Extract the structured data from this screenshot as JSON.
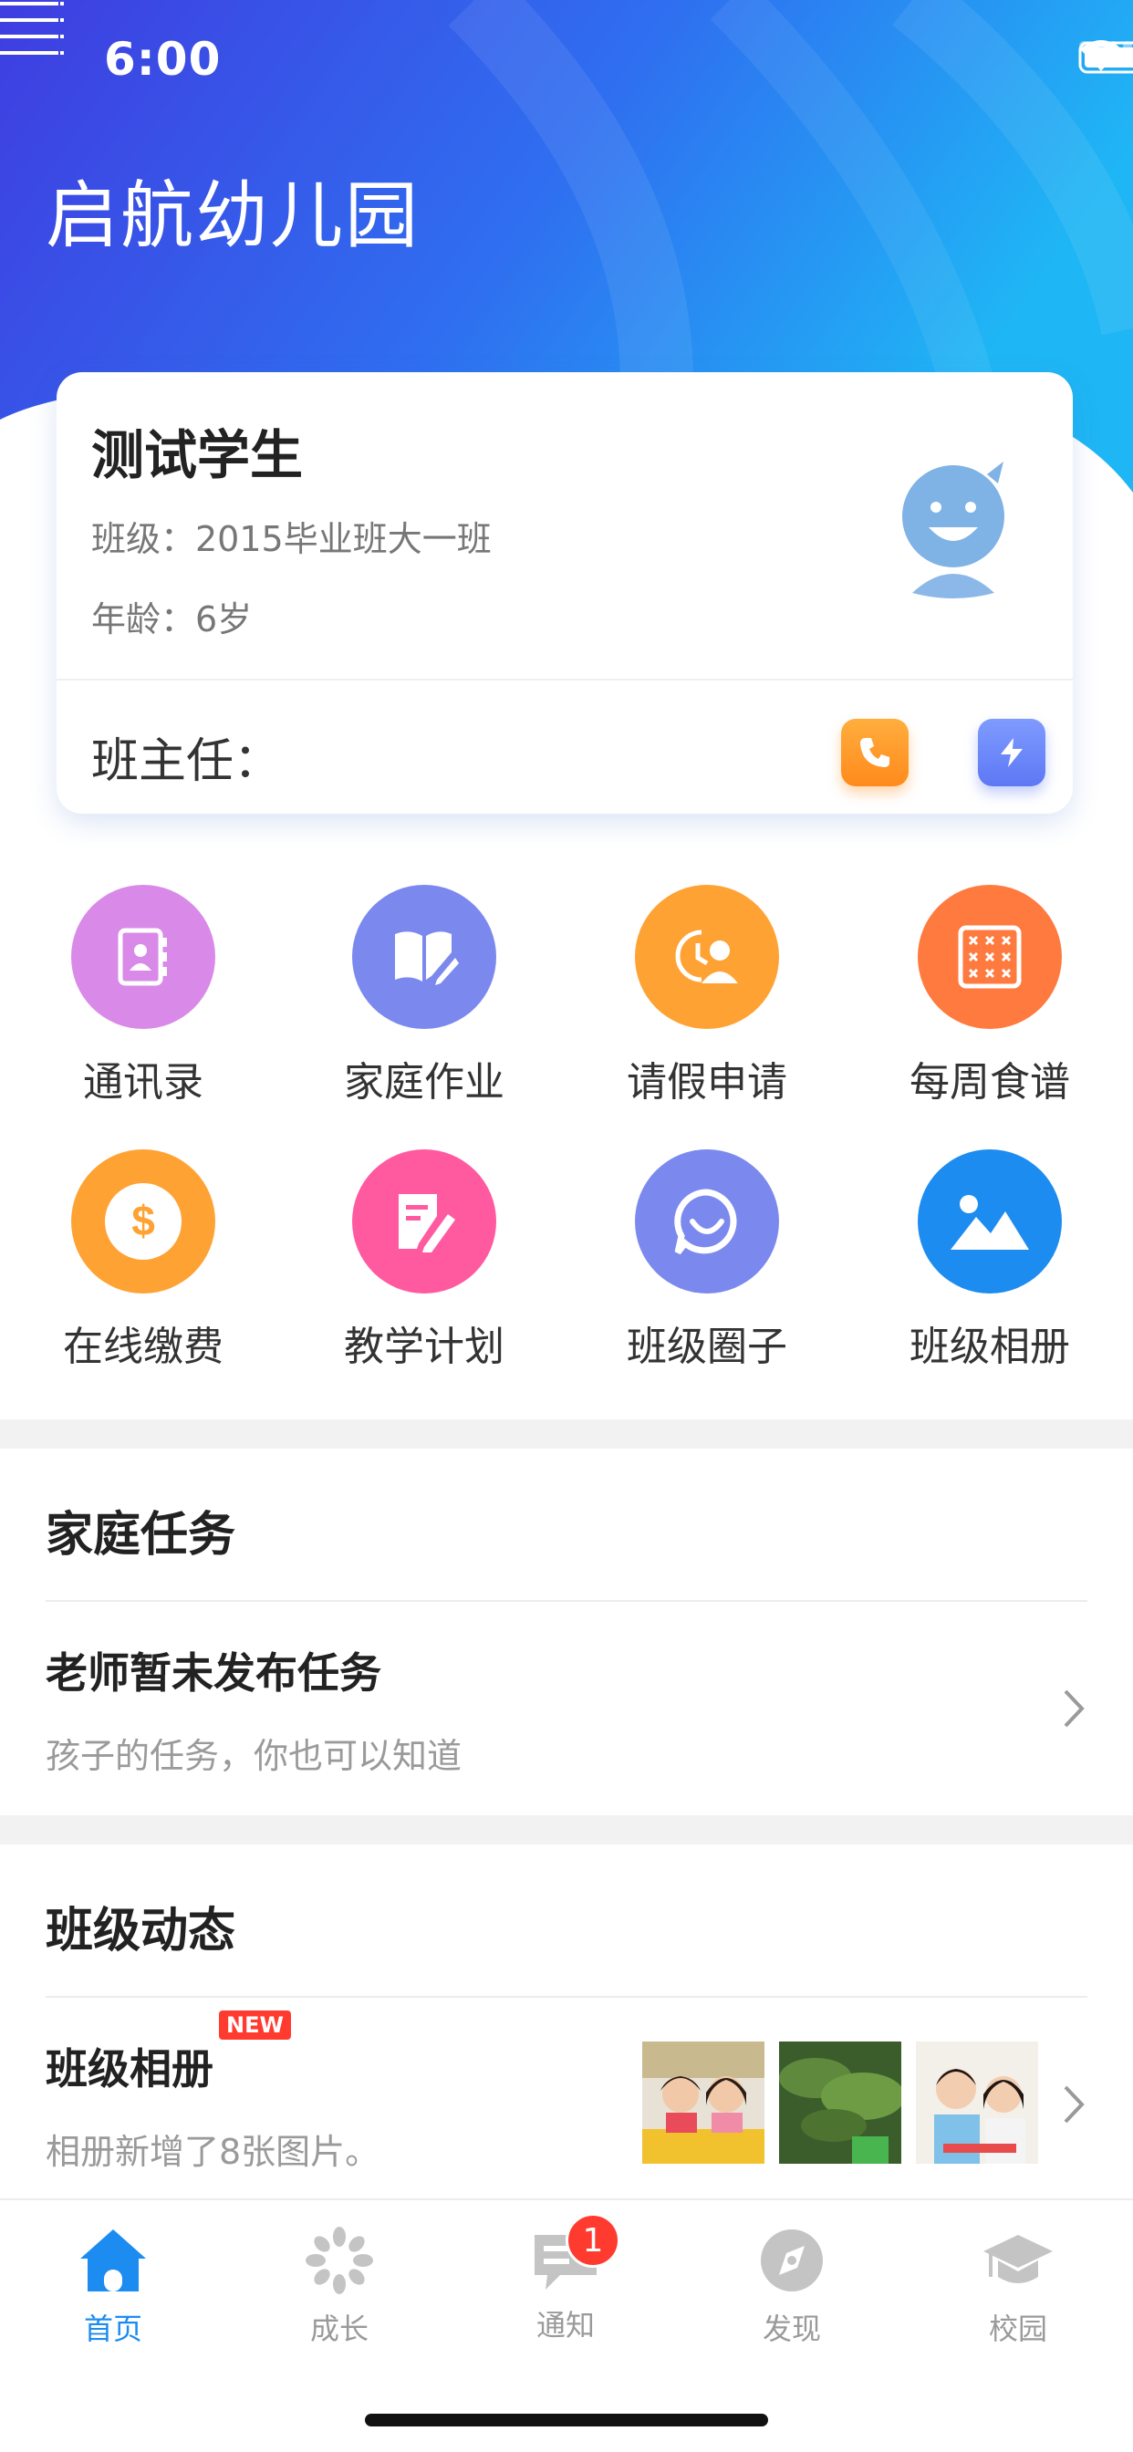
{
  "status_bar": {
    "time": "6:00"
  },
  "header": {
    "title": "启航幼儿园"
  },
  "student": {
    "name": "测试学生",
    "class_line": "班级：2015毕业班大一班",
    "age_line": "年龄：6岁",
    "teacher_label": "班主任："
  },
  "grid": [
    {
      "label": "通讯录",
      "color": "#d98ae8",
      "icon": "contacts-icon"
    },
    {
      "label": "家庭作业",
      "color": "#7b89ee",
      "icon": "book-edit-icon"
    },
    {
      "label": "请假申请",
      "color": "#ffa234",
      "icon": "leave-request-icon"
    },
    {
      "label": "每周食谱",
      "color": "#ff7a3e",
      "icon": "menu-grid-icon"
    },
    {
      "label": "在线缴费",
      "color": "#ffa234",
      "icon": "dollar-icon"
    },
    {
      "label": "教学计划",
      "color": "#ff5aa0",
      "icon": "plan-edit-icon"
    },
    {
      "label": "班级圈子",
      "color": "#7b89ee",
      "icon": "chat-smile-icon"
    },
    {
      "label": "班级相册",
      "color": "#1d8cf0",
      "icon": "image-icon"
    }
  ],
  "family_tasks": {
    "title": "家庭任务",
    "row_title": "老师暂未发布任务",
    "row_sub": "孩子的任务，你也可以知道"
  },
  "class_news": {
    "title": "班级动态",
    "row_title": "班级相册",
    "badge": "NEW",
    "row_sub": "相册新增了8张图片。"
  },
  "tabs": [
    {
      "label": "首页",
      "icon": "home-icon",
      "active": true
    },
    {
      "label": "成长",
      "icon": "growth-icon",
      "active": false
    },
    {
      "label": "通知",
      "icon": "notification-icon",
      "active": false,
      "badge": "1"
    },
    {
      "label": "发现",
      "icon": "compass-icon",
      "active": false
    },
    {
      "label": "校园",
      "icon": "campus-icon",
      "active": false
    }
  ],
  "colors": {
    "accent": "#1d8cf0",
    "badge": "#ff3b30"
  }
}
